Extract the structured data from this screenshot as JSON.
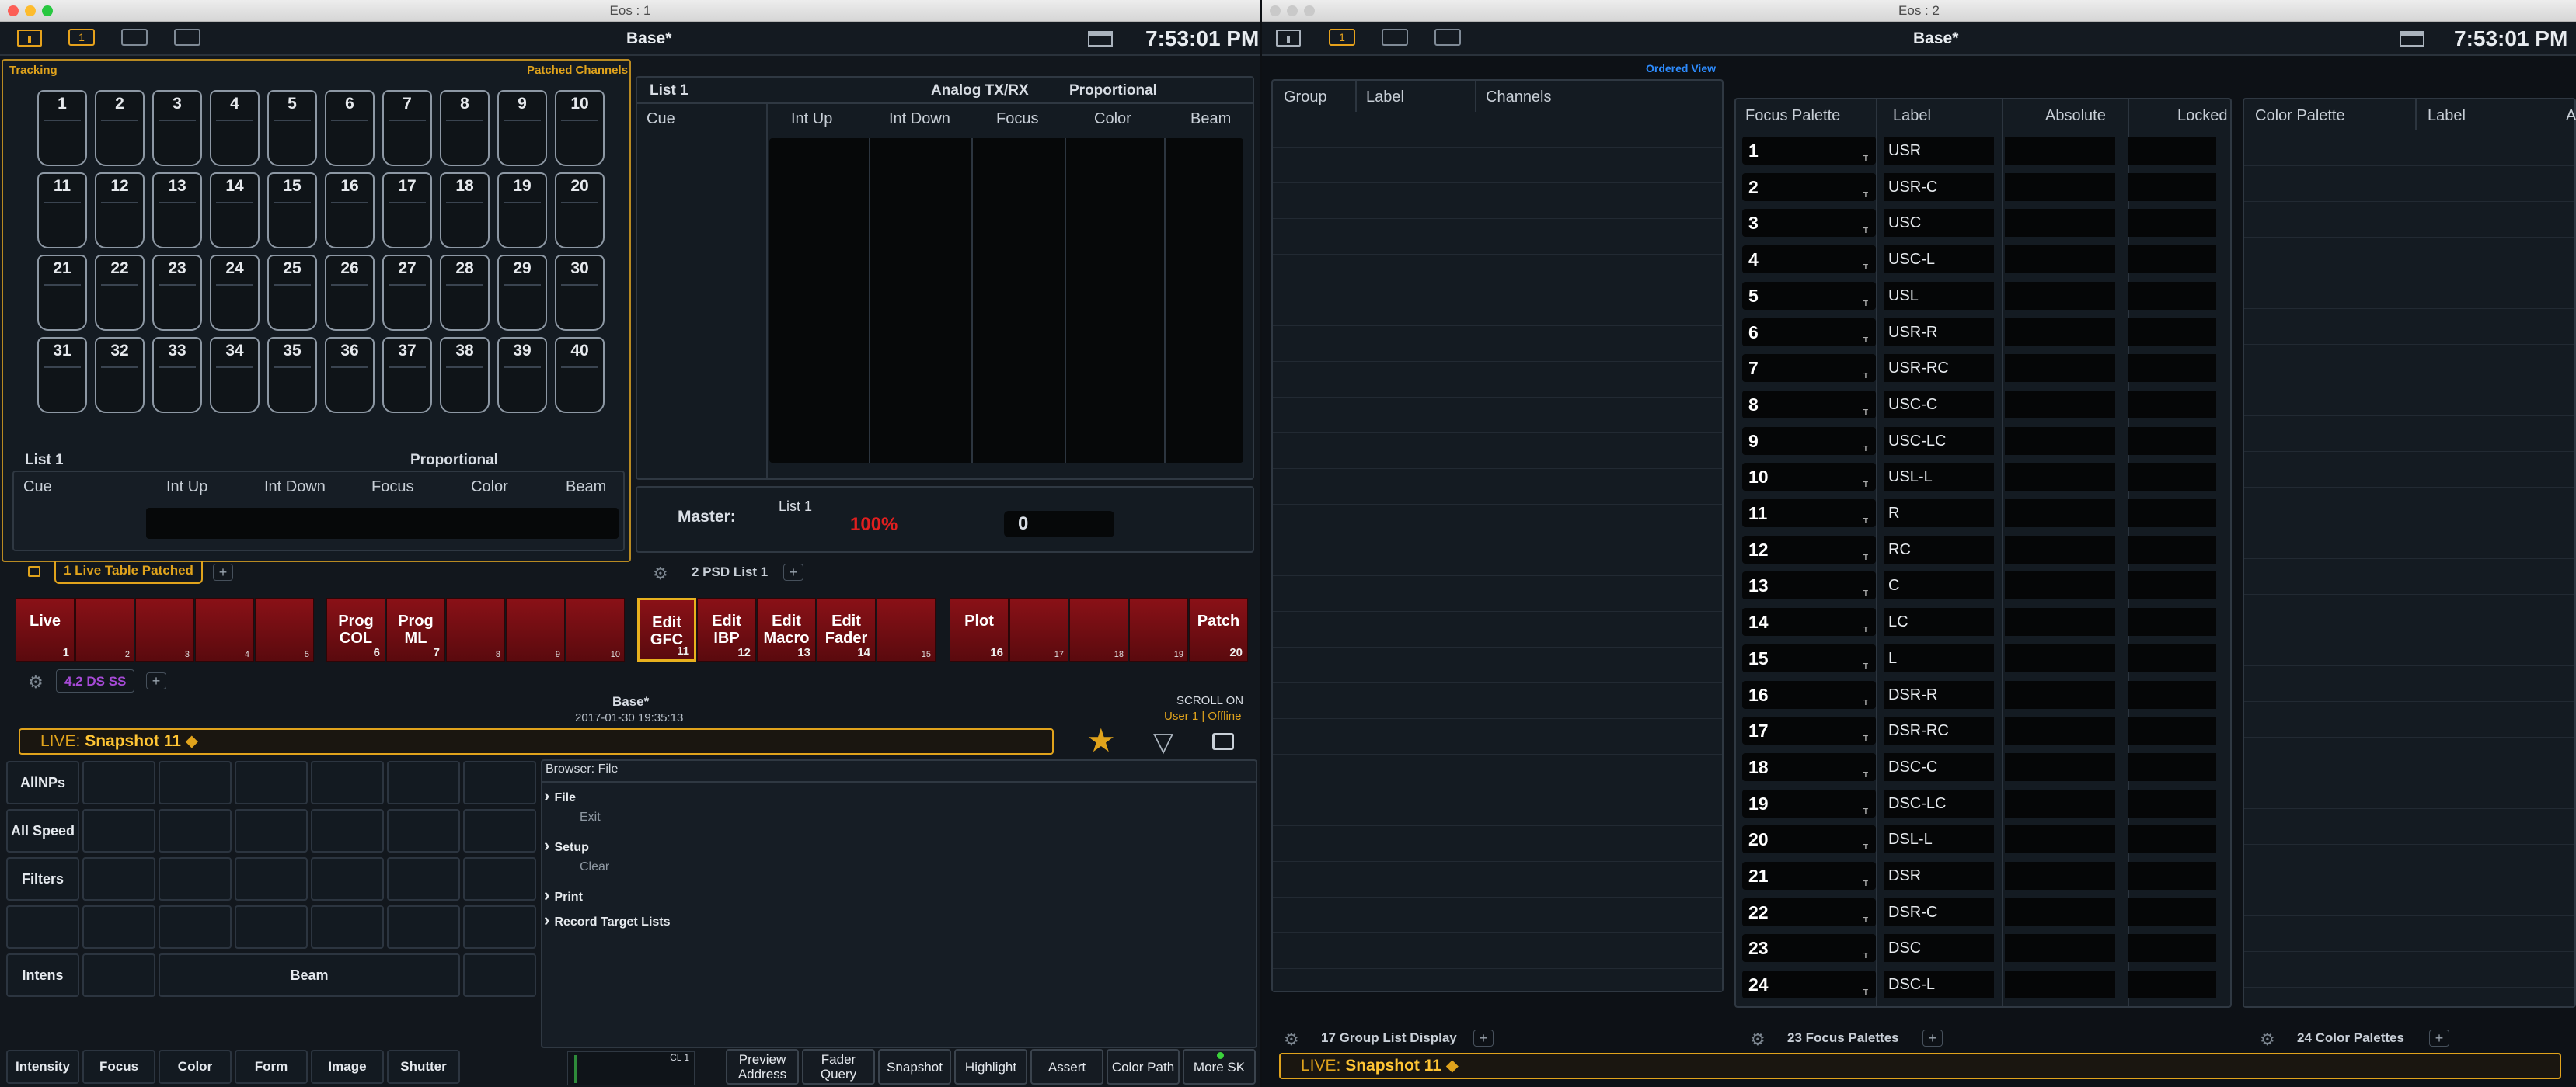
{
  "windows": [
    {
      "title": "Eos : 1",
      "topbar": {
        "badge": "1",
        "title": "Base*",
        "clock": "7:53:01 PM"
      }
    },
    {
      "title": "Eos : 2",
      "topbar": {
        "badge": "1",
        "title": "Base*",
        "clock": "7:53:01 PM"
      }
    }
  ],
  "live_table": {
    "tracking": "Tracking",
    "patched": "Patched Channels",
    "channels": [
      "1",
      "2",
      "3",
      "4",
      "5",
      "6",
      "7",
      "8",
      "9",
      "10",
      "11",
      "12",
      "13",
      "14",
      "15",
      "16",
      "17",
      "18",
      "19",
      "20",
      "21",
      "22",
      "23",
      "24",
      "25",
      "26",
      "27",
      "28",
      "29",
      "30",
      "31",
      "32",
      "33",
      "34",
      "35",
      "36",
      "37",
      "38",
      "39",
      "40"
    ],
    "list_label": "List 1",
    "proportional": "Proportional",
    "columns": [
      "Cue",
      "Int Up",
      "Int Down",
      "Focus",
      "Color",
      "Beam"
    ]
  },
  "psd": {
    "list_label": "List 1",
    "analog": "Analog TX/RX",
    "proportional": "Proportional",
    "columns": [
      "Cue",
      "Int Up",
      "Int Down",
      "Focus",
      "Color",
      "Beam"
    ],
    "master_label": "Master:",
    "master_list": "List 1",
    "master_pct": "100%",
    "master_value": "0"
  },
  "tabs_left": {
    "tab1": "1 Live Table Patched",
    "tab2": "2 PSD List 1",
    "plus": "+"
  },
  "softkeys_red": [
    {
      "label": "Live",
      "num": "1",
      "subs": [
        "2",
        "3",
        "4",
        "5"
      ]
    },
    {
      "label": "Prog COL",
      "num": "6"
    },
    {
      "label": "Prog ML",
      "num": "7"
    },
    {
      "label": "Edit GFC",
      "num": "11"
    },
    {
      "label": "Edit IBP",
      "num": "12"
    },
    {
      "label": "Edit Macro",
      "num": "13"
    },
    {
      "label": "Edit Fader",
      "num": "14"
    },
    {
      "label": "Plot",
      "num": "16"
    },
    {
      "label": "Patch",
      "num": "20"
    }
  ],
  "key_subnums": {
    "8": "8",
    "9": "9",
    "10": "10",
    "15": "15",
    "17": "17",
    "18": "18",
    "19": "19"
  },
  "ds_tab": {
    "label": "4.2 DS SS",
    "plus": "+"
  },
  "status": {
    "show": "Base*",
    "date": "2017-01-30 19:35:13",
    "scroll": "SCROLL ON",
    "user": "User 1 | Offline",
    "live_prefix": "LIVE:",
    "live_value": "Snapshot 11"
  },
  "direct_selects": {
    "row_labels": [
      "AllNPs",
      "All Speed",
      "Filters",
      "",
      "Intens"
    ],
    "beam": "Beam",
    "bottom": [
      "Intensity",
      "Focus",
      "Color",
      "Form",
      "Image",
      "Shutter"
    ]
  },
  "browser": {
    "title": "Browser: File",
    "items": [
      {
        "label": "File",
        "expand": true,
        "bold": true
      },
      {
        "label": "Exit",
        "sub": true
      },
      {
        "label": "Setup",
        "expand": true
      },
      {
        "label": "Clear",
        "sub": true
      },
      {
        "label": "Print",
        "expand": true
      },
      {
        "label": "Record Target Lists",
        "expand": true
      }
    ]
  },
  "bottom_softkeys": [
    {
      "l1": "Preview",
      "l2": "Address"
    },
    {
      "l1": "Fader",
      "l2": "Query"
    },
    {
      "l1": "",
      "l2": "Snapshot"
    },
    {
      "l1": "",
      "l2": "Highlight"
    },
    {
      "l1": "",
      "l2": "Assert"
    },
    {
      "l1": "",
      "l2": "Color Path"
    },
    {
      "l1": "",
      "l2": "More SK"
    }
  ],
  "cl_label": "CL 1",
  "group_list": {
    "ordered": "Ordered View",
    "columns": [
      "Group",
      "Label",
      "Channels"
    ],
    "tab": "17 Group List Display"
  },
  "focus_palettes": {
    "columns": [
      "Focus Palette",
      "Label",
      "Absolute",
      "Locked"
    ],
    "rows": [
      [
        "1",
        "USR"
      ],
      [
        "2",
        "USR-C"
      ],
      [
        "3",
        "USC"
      ],
      [
        "4",
        "USC-L"
      ],
      [
        "5",
        "USL"
      ],
      [
        "6",
        "USR-R"
      ],
      [
        "7",
        "USR-RC"
      ],
      [
        "8",
        "USC-C"
      ],
      [
        "9",
        "USC-LC"
      ],
      [
        "10",
        "USL-L"
      ],
      [
        "11",
        "R"
      ],
      [
        "12",
        "RC"
      ],
      [
        "13",
        "C"
      ],
      [
        "14",
        "LC"
      ],
      [
        "15",
        "L"
      ],
      [
        "16",
        "DSR-R"
      ],
      [
        "17",
        "DSR-RC"
      ],
      [
        "18",
        "DSC-C"
      ],
      [
        "19",
        "DSC-LC"
      ],
      [
        "20",
        "DSL-L"
      ],
      [
        "21",
        "DSR"
      ],
      [
        "22",
        "DSR-C"
      ],
      [
        "23",
        "DSC"
      ],
      [
        "24",
        "DSC-L"
      ]
    ],
    "tab": "23 Focus Palettes"
  },
  "color_palettes": {
    "columns": [
      "Color Palette",
      "Label",
      "A"
    ],
    "tab": "24 Color Palettes"
  },
  "live_right": {
    "prefix": "LIVE:",
    "value": "Snapshot 11"
  },
  "colors": {
    "accent": "#e0a31c",
    "red_key": "#7a0f14",
    "pct": "#e01f1f"
  }
}
